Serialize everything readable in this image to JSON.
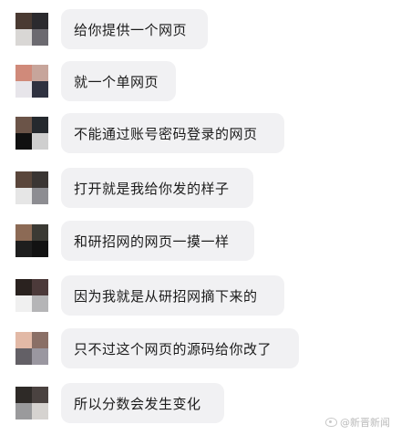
{
  "messages": [
    {
      "text": "给你提供一个网页",
      "avatar": [
        "#4a3a32",
        "#2b2a2e",
        "#d9d7d5",
        "#6c6a70"
      ]
    },
    {
      "text": "就一个单网页",
      "avatar": [
        "#d08a7a",
        "#c7a59b",
        "#e7e5ea",
        "#2f3240"
      ]
    },
    {
      "text": "不能通过账号密码登录的网页",
      "avatar": [
        "#6b5448",
        "#25292e",
        "#101010",
        "#cfcfcf"
      ]
    },
    {
      "text": "打开就是我给你发的样子",
      "avatar": [
        "#5a463b",
        "#3a3533",
        "#e6e6e6",
        "#8d8d92"
      ]
    },
    {
      "text": "和研招网的网页一摸一样",
      "avatar": [
        "#8c6a55",
        "#3b3a34",
        "#1e1e1e",
        "#121212"
      ]
    },
    {
      "text": "因为我就是从研招网摘下来的",
      "avatar": [
        "#2a221f",
        "#4c3a3a",
        "#f0f0f0",
        "#b5b5b7"
      ]
    },
    {
      "text": "只不过这个网页的源码给你改了",
      "avatar": [
        "#e2b9a6",
        "#8a6f66",
        "#636066",
        "#9a97a0"
      ]
    },
    {
      "text": "所以分数会发生变化",
      "avatar": [
        "#2e2a27",
        "#4a4240",
        "#9a9a9c",
        "#d6d3d0"
      ]
    }
  ],
  "watermark": {
    "text": "@新晋新闻",
    "icon": "weibo-icon"
  }
}
